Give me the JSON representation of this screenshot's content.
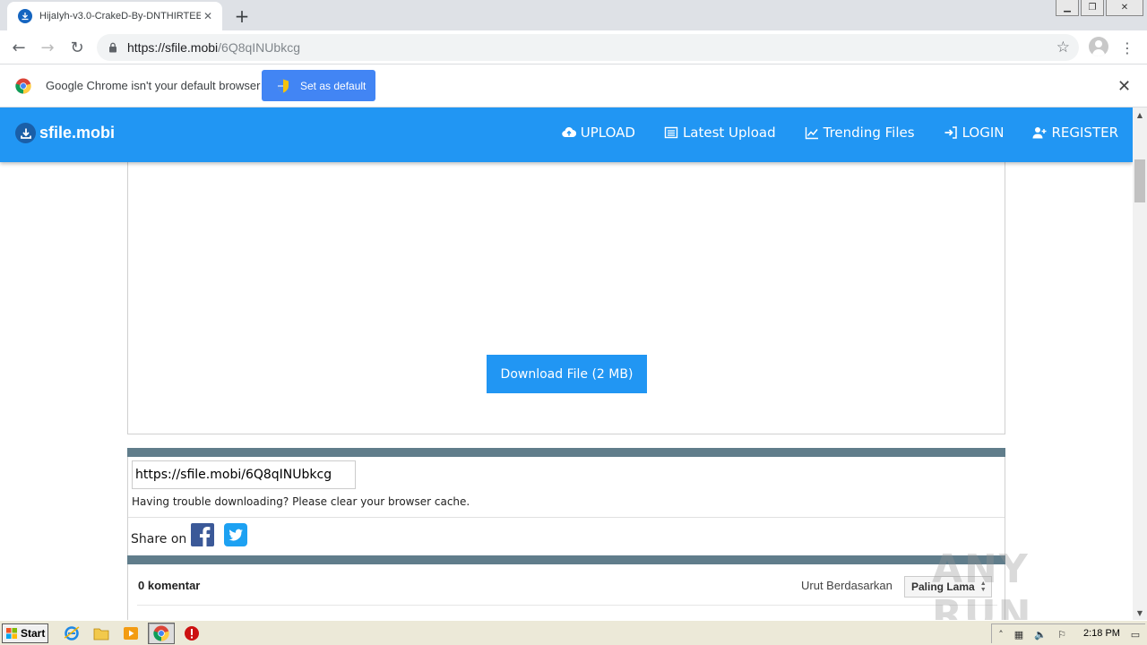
{
  "browser": {
    "tab_title": "HijaIyh-v3.0-CrakeD-By-DNTHIRTEE",
    "url_host": "https://sfile.mobi",
    "url_path": "/6Q8qINUbkcg",
    "infobar_message": "Google Chrome isn't your default browser",
    "infobar_button": "Set as default"
  },
  "site": {
    "brand": "sfile.mobi",
    "nav": [
      {
        "label": "UPLOAD",
        "icon": "cloud-upload-icon"
      },
      {
        "label": "Latest Upload",
        "icon": "list-icon"
      },
      {
        "label": "Trending Files",
        "icon": "chart-line-icon"
      },
      {
        "label": "LOGIN",
        "icon": "sign-in-icon"
      },
      {
        "label": "REGISTER",
        "icon": "user-plus-icon"
      }
    ],
    "brand_color": "#2196f3",
    "divider_color": "#607d8b"
  },
  "download": {
    "button_label": "Download File (2 MB)"
  },
  "share": {
    "link_value": "https://sfile.mobi/6Q8qINUbkcg",
    "trouble_text": "Having trouble downloading? Please clear your browser cache.",
    "share_label": "Share on"
  },
  "comments": {
    "count_label": "0 komentar",
    "sort_label": "Urut Berdasarkan",
    "sort_value": "Paling Lama"
  },
  "watermark": "ANY RUN",
  "taskbar": {
    "start_label": "Start",
    "clock": "2:18 PM"
  }
}
